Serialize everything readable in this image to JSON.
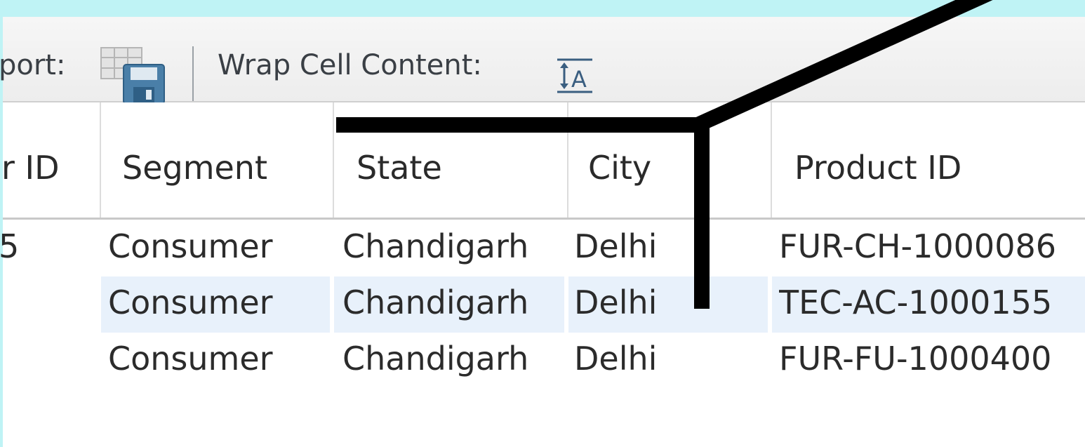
{
  "toolbar": {
    "export_label": "port:",
    "export_icon": "save-grid-icon",
    "wrap_label": "Wrap Cell Content:",
    "wrap_icon": "text-wrap-icon"
  },
  "table": {
    "columns": [
      "r ID",
      "Segment",
      "State",
      "City",
      "Product ID"
    ],
    "rows": [
      [
        "5",
        "Consumer",
        "Chandigarh",
        "Delhi",
        "FUR-CH-1000086"
      ],
      [
        "",
        "Consumer",
        "Chandigarh",
        "Delhi",
        "TEC-AC-1000155"
      ],
      [
        "",
        "Consumer",
        "Chandigarh",
        "Delhi",
        "FUR-FU-1000400"
      ]
    ],
    "selected_row": 1
  },
  "colors": {
    "frame": "#bff3f5",
    "selected_row": "#e8f1fb",
    "annotation": "#000000"
  }
}
